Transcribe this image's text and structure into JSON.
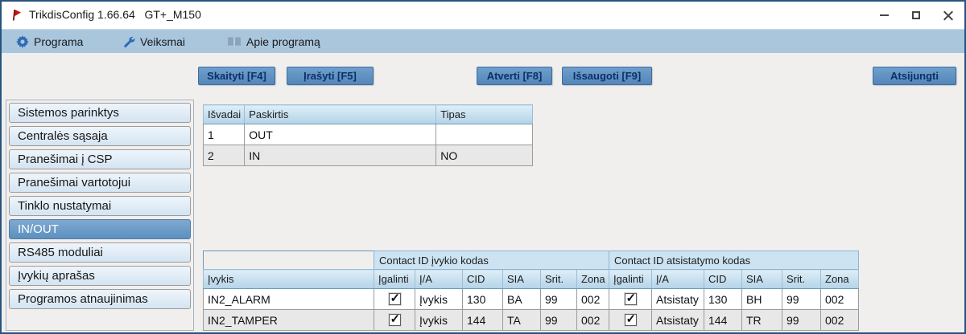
{
  "window": {
    "title": "TrikdisConfig 1.66.64   GT+_M150"
  },
  "menu": {
    "items": [
      {
        "icon": "gear-icon",
        "label": "Programa"
      },
      {
        "icon": "wrench-icon",
        "label": "Veiksmai"
      },
      {
        "icon": "book-icon",
        "label": "Apie programą"
      }
    ]
  },
  "toolbar": {
    "read_label": "Skaityti [F4]",
    "write_label": "Įrašyti [F5]",
    "open_label": "Atverti [F8]",
    "save_label": "Išsaugoti [F9]",
    "disconnect_label": "Atsijungti"
  },
  "sidebar": {
    "selected": "IN/OUT",
    "items": [
      "Sistemos parinktys",
      "Centralės sąsaja",
      "Pranešimai į CSP",
      "Pranešimai vartotojui",
      "Tinklo nustatymai",
      "IN/OUT",
      "RS485 moduliai",
      "Įvykių aprašas",
      "Programos atnaujinimas"
    ]
  },
  "io_table": {
    "columns": [
      "Išvadai",
      "Paskirtis",
      "Tipas"
    ],
    "rows": [
      [
        "1",
        "OUT",
        ""
      ],
      [
        "2",
        "IN",
        "NO"
      ]
    ]
  },
  "event_table": {
    "group_headers": [
      "Contact ID įvykio kodas",
      "Contact ID atsistatymo kodas"
    ],
    "columns": [
      "Įvykis",
      "Įgalinti",
      "Į/A",
      "CID",
      "SIA",
      "Srit.",
      "Zona",
      "Įgalinti",
      "Į/A",
      "CID",
      "SIA",
      "Srit.",
      "Zona"
    ],
    "rows": [
      {
        "event": "IN2_ALARM",
        "ev": {
          "enabled": true,
          "ia": "Įvykis",
          "cid": "130",
          "sia": "BA",
          "srit": "99",
          "zona": "002"
        },
        "rst": {
          "enabled": true,
          "ia": "Atsistaty",
          "cid": "130",
          "sia": "BH",
          "srit": "99",
          "zona": "002"
        }
      },
      {
        "event": "IN2_TAMPER",
        "ev": {
          "enabled": true,
          "ia": "Įvykis",
          "cid": "144",
          "sia": "TA",
          "srit": "99",
          "zona": "002"
        },
        "rst": {
          "enabled": true,
          "ia": "Atsistaty",
          "cid": "144",
          "sia": "TR",
          "srit": "99",
          "zona": "002"
        }
      }
    ]
  }
}
